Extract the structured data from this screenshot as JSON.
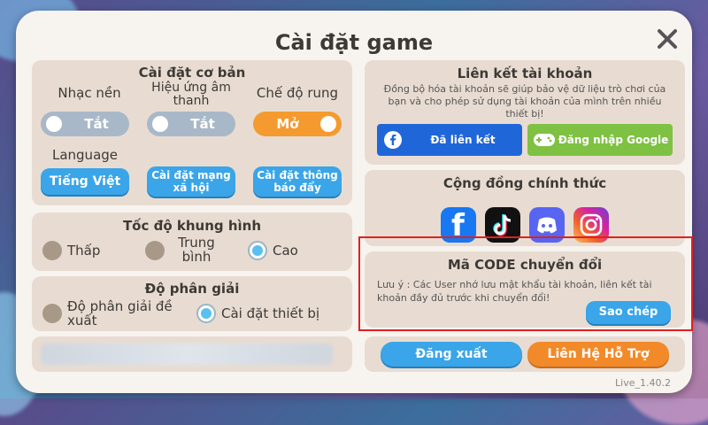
{
  "dialog": {
    "title": "Cài đặt game",
    "version": "Live_1.40.2"
  },
  "basic": {
    "title": "Cài đặt cơ bản",
    "music": {
      "label": "Nhạc nền",
      "state": "Tắt"
    },
    "sfx": {
      "label": "Hiệu ứng âm thanh",
      "state": "Tắt"
    },
    "vibration": {
      "label": "Chế độ rung",
      "state": "Mở"
    },
    "language": {
      "label": "Language",
      "value": "Tiếng Việt"
    },
    "social_btn": "Cài đặt mạng xã hội",
    "notif_btn": "Cài đặt thông báo đẩy"
  },
  "framerate": {
    "title": "Tốc độ khung hình",
    "options": [
      "Thấp",
      "Trung bình",
      "Cao"
    ],
    "selected": "Cao"
  },
  "resolution": {
    "title": "Độ phân giải",
    "options": [
      "Độ phân giải đề xuất",
      "Cài đặt thiết bị"
    ],
    "selected": "Cài đặt thiết bị"
  },
  "account": {
    "title": "Liên kết tài khoản",
    "desc": "Đồng bộ hóa tài khoản sẽ giúp bảo vệ dữ liệu trò chơi của bạn và cho phép sử dụng tài khoản của mình trên nhiều thiết bị!",
    "facebook": "Đã liên kết",
    "google": "Đăng nhập Google"
  },
  "community": {
    "title": "Cộng đồng chính thức"
  },
  "transfer": {
    "title": "Mã CODE chuyển đổi",
    "note": "Lưu ý : Các User nhớ lưu mật khẩu tài khoản, liên kết tài khoản đầy đủ trước khi chuyển đổi!",
    "copy": "Sao chép"
  },
  "logout": "Đăng xuất",
  "support": "Liên Hệ Hỗ Trợ",
  "colors": {
    "dialog_bg": "#f7f3ee",
    "panel_bg": "#e8dcd2",
    "toggle_off": "#a8b8c8",
    "toggle_on": "#f59a2e",
    "blue": "#3aa5e8",
    "facebook": "#1f66d9",
    "google": "#7fc143",
    "orange": "#f28a2a",
    "highlight": "#e02020"
  }
}
